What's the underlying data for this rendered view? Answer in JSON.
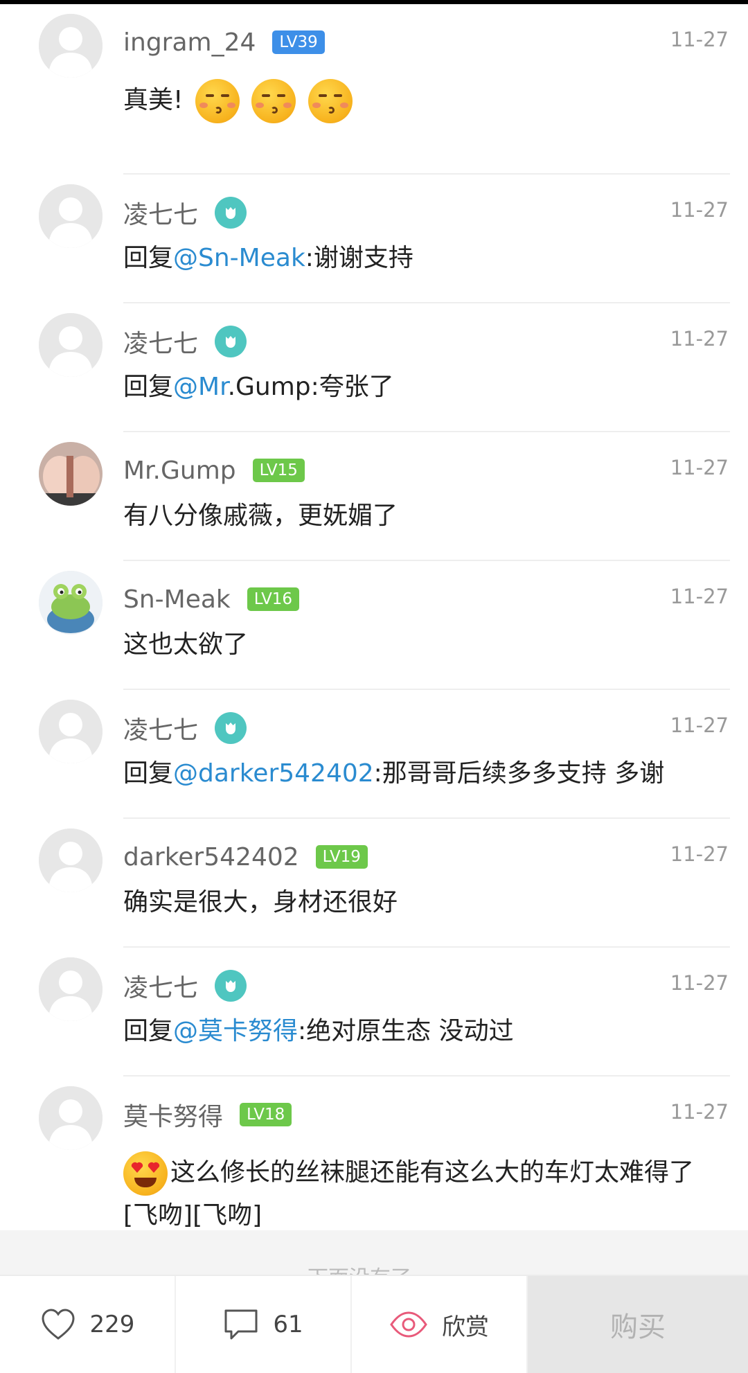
{
  "comments": [
    {
      "user": "ingram_24",
      "level": "LV39",
      "date": "11-27",
      "text": "真美!"
    },
    {
      "user": "凌七七",
      "date": "11-27",
      "prefix": "回复",
      "mention": "@Sn-Meak",
      "text": ":谢谢支持"
    },
    {
      "user": "凌七七",
      "date": "11-27",
      "prefix": "回复",
      "mention": "@Mr",
      "text": ".Gump:夸张了"
    },
    {
      "user": "Mr.Gump",
      "level": "LV15",
      "date": "11-27",
      "text": "有八分像戚薇，更妩媚了"
    },
    {
      "user": "Sn-Meak",
      "level": "LV16",
      "date": "11-27",
      "text": "这也太欲了"
    },
    {
      "user": "凌七七",
      "date": "11-27",
      "prefix": "回复",
      "mention": "@darker542402",
      "text": ":那哥哥后续多多支持 多谢"
    },
    {
      "user": "darker542402",
      "level": "LV19",
      "date": "11-27",
      "text": "确实是很大，身材还很好"
    },
    {
      "user": "凌七七",
      "date": "11-27",
      "prefix": "回复",
      "mention": "@莫卡努得",
      "text": ":绝对原生态 没动过"
    },
    {
      "user": "莫卡努得",
      "level": "LV18",
      "date": "11-27",
      "text": "这么修长的丝袜腿还能有这么大的车灯太难得了[飞吻][飞吻]"
    }
  ],
  "footer_note": "下面没有了",
  "bottom_bar": {
    "like_count": "229",
    "comment_count": "61",
    "view_label": "欣赏",
    "buy_label": "购买"
  },
  "colors": {
    "mention": "#2a8bd0",
    "level_blue": "#3d8fe8",
    "level_green": "#6dc84a",
    "author_badge": "#4fc6c0",
    "view_accent": "#e85a7a"
  }
}
